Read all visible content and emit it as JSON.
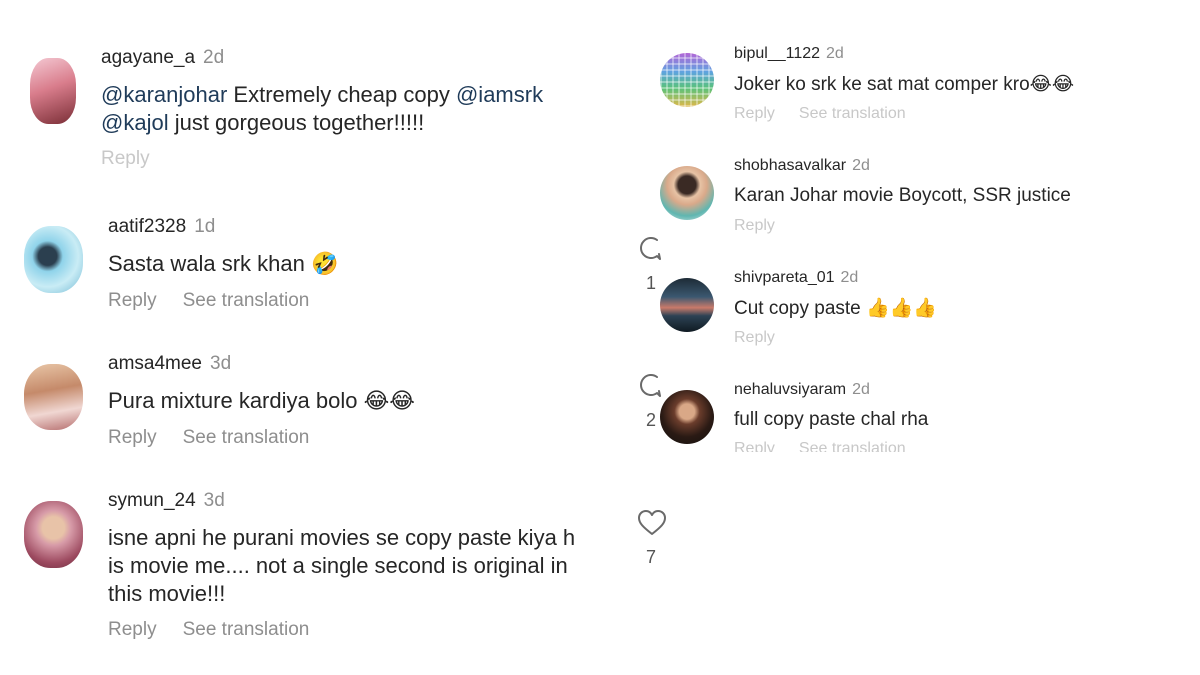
{
  "left_comments": [
    {
      "username": "agayane_a",
      "time": "2d",
      "text_parts": [
        "@karanjohar",
        " Extremely cheap copy ",
        "@iamsrk",
        "@kajol",
        " just gorgeous together!!!!!"
      ],
      "reply": "Reply"
    },
    {
      "username": "aatif2328",
      "time": "1d",
      "text": "Sasta  wala srk khan",
      "emoji": "🤣",
      "reply": "Reply",
      "translate": "See translation"
    },
    {
      "username": "amsa4mee",
      "time": "3d",
      "text": "Pura mixture kardiya bolo",
      "emoji": "😂😂",
      "reply": "Reply",
      "translate": "See translation"
    },
    {
      "username": "symun_24",
      "time": "3d",
      "lines": [
        "isne apni he purani movies se copy paste kiya h",
        "is movie me.... not a single second is original in",
        "this movie!!!"
      ],
      "reply": "Reply",
      "translate": "See translation"
    }
  ],
  "right_comments": [
    {
      "username": "bipul__1122",
      "time": "2d",
      "text": "Joker ko srk ke sat mat comper kro",
      "emoji": "😂😂",
      "reply": "Reply",
      "translate": "See translation"
    },
    {
      "username": "shobhasavalkar",
      "time": "2d",
      "text": "Karan Johar  movie Boycott, SSR justice",
      "reply": "Reply"
    },
    {
      "username": "shivpareta_01",
      "time": "2d",
      "text": "Cut copy paste",
      "emoji": "👍👍👍",
      "reply": "Reply"
    },
    {
      "username": "nehaluvsiyaram",
      "time": "2d",
      "text": "full copy paste chal rha",
      "reply": "Reply",
      "translate": "See translation"
    }
  ],
  "side_actions": {
    "reply_count_1": "1",
    "reply_count_2": "2",
    "like_count": "7"
  },
  "colors": {
    "mention": "#1f3b59",
    "muted": "#8e8e8e",
    "text": "#262626"
  }
}
